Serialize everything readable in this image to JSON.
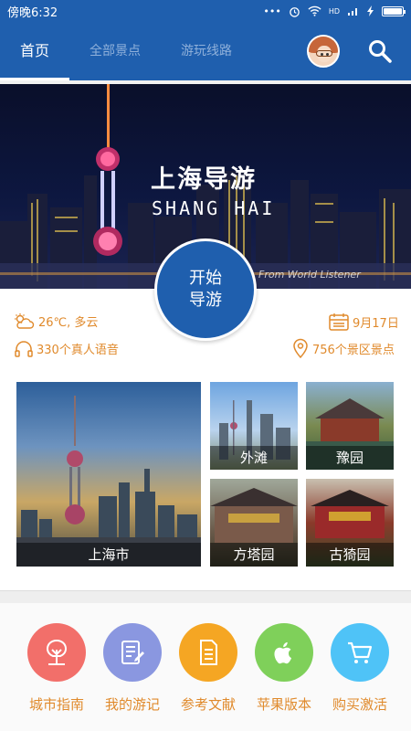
{
  "status_bar": {
    "time": "傍晚6:32",
    "network": "HD"
  },
  "nav": {
    "tabs": [
      {
        "label": "首页",
        "active": true
      },
      {
        "label": "全部景点",
        "active": false
      },
      {
        "label": "游玩线路",
        "active": false
      }
    ],
    "avatar_icon": "user-avatar",
    "search_icon": "search-icon"
  },
  "banner": {
    "title": "上海导游",
    "subtitle": "SHANG HAI",
    "credit": "From World Listener"
  },
  "start_button": {
    "line1": "开始",
    "line2": "导游"
  },
  "info": {
    "weather": "26℃, 多云",
    "date": "9月17日",
    "audio": "330个真人语音",
    "spots": "756个景区景点"
  },
  "tiles": [
    {
      "label": "上海市"
    },
    {
      "label": "外滩"
    },
    {
      "label": "豫园"
    },
    {
      "label": "方塔园"
    },
    {
      "label": "古猗园"
    }
  ],
  "menu": [
    {
      "label": "城市指南",
      "color": "#f26f6a",
      "icon": "tree-icon"
    },
    {
      "label": "我的游记",
      "color": "#8a97e0",
      "icon": "notes-icon"
    },
    {
      "label": "参考文献",
      "color": "#f5a623",
      "icon": "document-icon"
    },
    {
      "label": "苹果版本",
      "color": "#7fd05a",
      "icon": "apple-icon"
    },
    {
      "label": "购买激活",
      "color": "#4fc3f7",
      "icon": "cart-icon"
    }
  ],
  "colors": {
    "primary": "#1f5fae",
    "accent": "#e08a2c"
  }
}
